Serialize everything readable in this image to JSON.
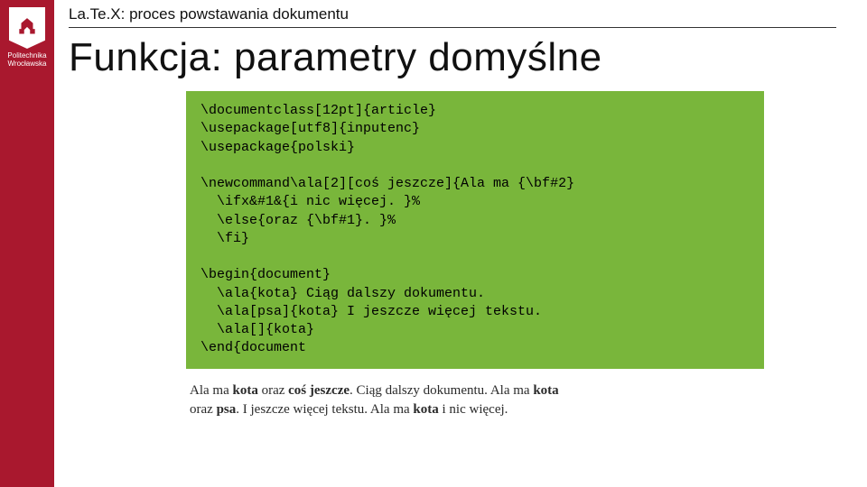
{
  "header": "La.Te.X: proces powstawania dokumentu",
  "title": "Funkcja: parametry domyślne",
  "logo": {
    "line1": "Politechnika",
    "line2": "Wrocławska"
  },
  "code": {
    "l01": "\\documentclass[12pt]{article}",
    "l02": "\\usepackage[utf8]{inputenc}",
    "l03": "\\usepackage{polski}",
    "l04": "",
    "l05": "\\newcommand\\ala[2][coś jeszcze]{Ala ma {\\bf#2}",
    "l06": "  \\ifx&#1&{i nic więcej. }%",
    "l07": "  \\else{oraz {\\bf#1}. }%",
    "l08": "  \\fi}",
    "l09": "",
    "l10": "\\begin{document}",
    "l11": "  \\ala{kota} Ciąg dalszy dokumentu.",
    "l12": "  \\ala[psa]{kota} I jeszcze więcej tekstu.",
    "l13": "  \\ala[]{kota}",
    "l14": "\\end{document"
  },
  "output": {
    "p1a": "Ala ma ",
    "p1b": "kota",
    "p1c": " oraz ",
    "p1d": "coś jeszcze",
    "p1e": ". Ciąg dalszy dokumentu. Ala ma ",
    "p1f": "kota",
    "p2a": "oraz ",
    "p2b": "psa",
    "p2c": ". I jeszcze więcej tekstu. Ala ma ",
    "p2d": "kota",
    "p2e": " i nic więcej."
  }
}
